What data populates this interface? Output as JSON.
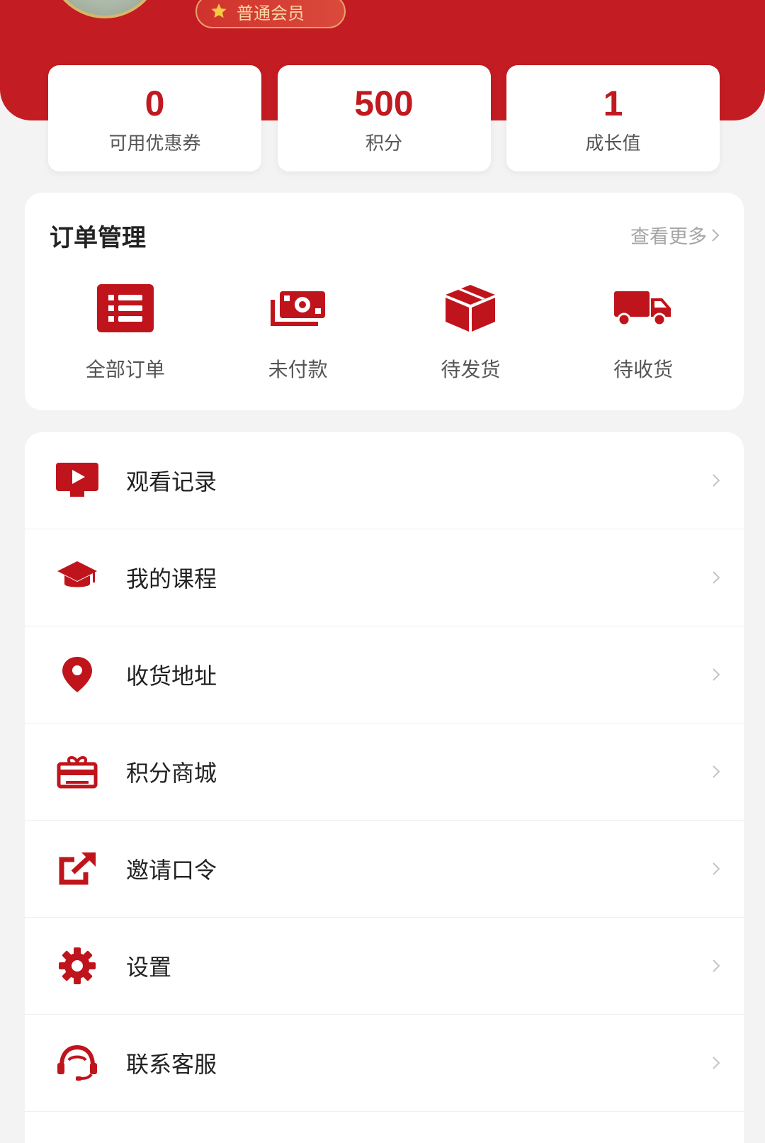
{
  "profile": {
    "member_level": "普通会员"
  },
  "stats": [
    {
      "value": "0",
      "label": "可用优惠券"
    },
    {
      "value": "500",
      "label": "积分"
    },
    {
      "value": "1",
      "label": "成长值"
    }
  ],
  "orders": {
    "title": "订单管理",
    "view_more": "查看更多",
    "items": [
      {
        "label": "全部订单",
        "icon": "list-icon"
      },
      {
        "label": "未付款",
        "icon": "cash-icon"
      },
      {
        "label": "待发货",
        "icon": "package-icon"
      },
      {
        "label": "待收货",
        "icon": "truck-icon"
      }
    ]
  },
  "menu": [
    {
      "label": "观看记录",
      "icon": "play-icon"
    },
    {
      "label": "我的课程",
      "icon": "graduation-cap-icon"
    },
    {
      "label": "收货地址",
      "icon": "location-pin-icon"
    },
    {
      "label": "积分商城",
      "icon": "gift-icon"
    },
    {
      "label": "邀请口令",
      "icon": "share-icon"
    },
    {
      "label": "设置",
      "icon": "gear-icon"
    },
    {
      "label": "联系客服",
      "icon": "headset-icon"
    }
  ],
  "colors": {
    "brand_red": "#c31c22",
    "icon_red": "#c0141c",
    "badge_text": "#f8d9a3",
    "page_bg": "#f4f3f3"
  }
}
